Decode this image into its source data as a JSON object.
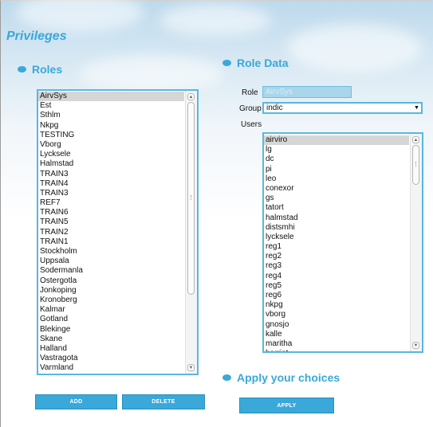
{
  "page": {
    "title": "Privileges"
  },
  "roles": {
    "heading": "Roles",
    "items": [
      "AirvSys",
      "Est",
      "Sthlm",
      "Nkpg",
      "TESTING",
      "Vborg",
      "Lycksele",
      "Halmstad",
      "TRAIN3",
      "TRAIN4",
      "TRAIN3",
      "REF7",
      "TRAIN6",
      "TRAIN5",
      "TRAIN2",
      "TRAIN1",
      "Stockholm",
      "Uppsala",
      "Sodermanla",
      "Ostergotla",
      "Jonkoping",
      "Kronoberg",
      "Kalmar",
      "Gotland",
      "Blekinge",
      "Skane",
      "Halland",
      "Vastragota",
      "Varmland"
    ],
    "selected_index": 0,
    "add_label": "ADD",
    "delete_label": "DELETE"
  },
  "role_data": {
    "heading": "Role Data",
    "role_label": "Role",
    "role_value": "AirvSys",
    "group_label": "Group",
    "group_value": "indic",
    "users_label": "Users",
    "users": [
      "airviro",
      "lg",
      "dc",
      "pi",
      "leo",
      "conexor",
      "gs",
      "tatort",
      "halmstad",
      "distsmhi",
      "lycksele",
      "reg1",
      "reg2",
      "reg3",
      "reg4",
      "reg5",
      "reg6",
      "nkpg",
      "vborg",
      "gnosjo",
      "kalle",
      "maritha",
      "harriet"
    ],
    "selected_index": 0
  },
  "apply": {
    "heading": "Apply your choices",
    "button_label": "APPLY"
  },
  "colors": {
    "accent": "#3aa8d8",
    "border": "#58b7e0",
    "selected": "#d6d6d6"
  },
  "icons": {
    "bullet": "bullet-icon",
    "scroll_up": "scroll-up-arrow-icon",
    "scroll_down": "scroll-down-arrow-icon",
    "dropdown": "dropdown-arrow-icon"
  }
}
